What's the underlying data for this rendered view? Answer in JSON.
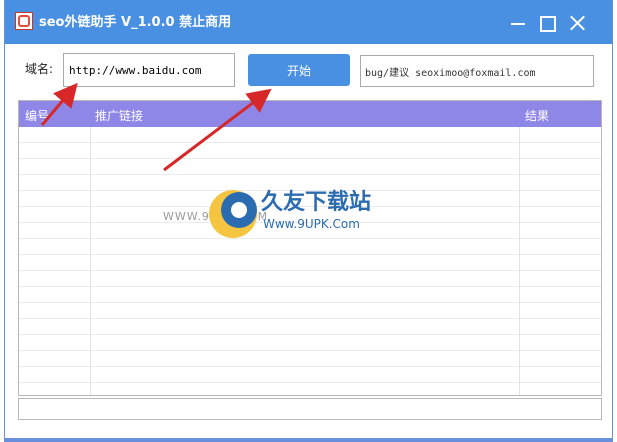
{
  "window": {
    "title": "seo外链助手 V_1.0.0   禁止商用"
  },
  "form": {
    "domain_label": "域名:",
    "domain_value": "http://www.baidu.com",
    "start_label": "开始",
    "contact_value": "bug/建议 seoximoo@foxmail.com"
  },
  "table": {
    "columns": [
      "编号",
      "推广链接",
      "结果"
    ],
    "rows": []
  },
  "watermark": {
    "left_text": "WWW.9UPK.COM",
    "title": "久友下载站",
    "subtitle": "Www.9UPK.Com"
  },
  "colors": {
    "titlebar": "#4a90e2",
    "button": "#4a90e2",
    "table_header": "#8e87e8",
    "arrow": "#d62828"
  }
}
